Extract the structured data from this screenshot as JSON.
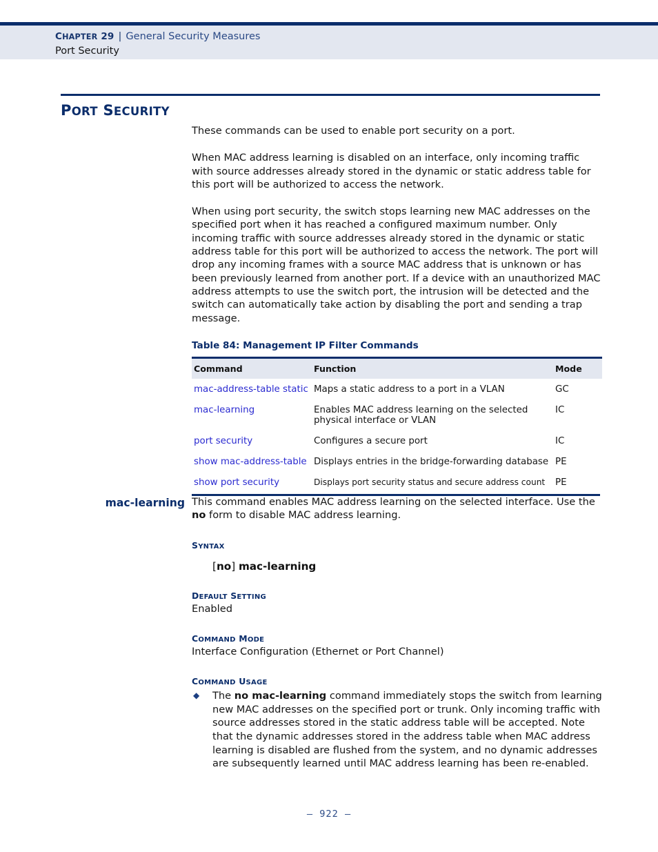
{
  "header": {
    "chapter_label": "Chapter 29",
    "chapter_prefix": "C",
    "chapter_rest": "HAPTER",
    "chapter_number": "29",
    "separator": "|",
    "topic": "General Security Measures",
    "subtitle": "Port Security"
  },
  "section": {
    "title_first": "P",
    "title_first_rest": "ORT",
    "title_second": "S",
    "title_second_rest": "ECURITY",
    "title_plain": "Port Security"
  },
  "intro": {
    "p1": "These commands can be used to enable port security on a port.",
    "p2": "When MAC address learning is disabled on an interface, only incoming traffic with source addresses already stored in the dynamic or static address table for this port will be authorized to access the network.",
    "p3": "When using port security, the switch stops learning new MAC addresses on the specified port when it has reached a configured maximum number. Only incoming traffic with source addresses already stored in the dynamic or static address table for this port will be authorized to access the network. The port will drop any incoming frames with a source MAC address that is unknown or has been previously learned from another port. If a device with an unauthorized MAC address attempts to use the switch port, the intrusion will be detected and the switch can automatically take action by disabling the port and sending a trap message."
  },
  "table": {
    "caption": "Table 84: Management IP Filter Commands",
    "columns": [
      "Command",
      "Function",
      "Mode"
    ],
    "rows": [
      {
        "command": "mac-address-table static",
        "function": "Maps a static address to a port in a VLAN",
        "mode": "GC"
      },
      {
        "command": "mac-learning",
        "function": "Enables MAC address learning on the selected physical interface or VLAN",
        "mode": "IC"
      },
      {
        "command": "port security",
        "function": "Configures a secure port",
        "mode": "IC"
      },
      {
        "command": "show mac-address-table",
        "function": "Displays entries in the bridge-forwarding database",
        "mode": "PE"
      },
      {
        "command": "show port security",
        "function": "Displays port security status and secure address count",
        "mode": "PE"
      }
    ]
  },
  "command_entry": {
    "name": "mac-learning",
    "intro_part1": "This command enables MAC address learning on the selected interface. Use the ",
    "intro_bold": "no",
    "intro_part2": " form to disable MAC address learning.",
    "syntax_heading_first": "S",
    "syntax_heading_rest": "YNTAX",
    "syntax_open_bracket": "[",
    "syntax_no": "no",
    "syntax_close_bracket": "]",
    "syntax_command": "mac-learning",
    "default_heading_first1": "D",
    "default_heading_rest1": "EFAULT",
    "default_heading_first2": "S",
    "default_heading_rest2": "ETTING",
    "default_value": "Enabled",
    "mode_heading_first1": "C",
    "mode_heading_rest1": "OMMAND",
    "mode_heading_first2": "M",
    "mode_heading_rest2": "ODE",
    "mode_value": "Interface Configuration (Ethernet or Port Channel)",
    "usage_heading_first1": "C",
    "usage_heading_rest1": "OMMAND",
    "usage_heading_first2": "U",
    "usage_heading_rest2": "SAGE",
    "usage_bullet_glyph": "◆",
    "usage_part1": "The ",
    "usage_bold": "no mac-learning",
    "usage_part2": " command immediately stops the switch from learning new MAC addresses on the specified port or trunk. Only incoming traffic with source addresses stored in the static address table will be accepted. Note that the dynamic addresses stored in the address table when MAC address learning is disabled are flushed from the system, and no dynamic addresses are subsequently learned until MAC address learning has been re-enabled."
  },
  "footer": {
    "page_marker": "–  922  –"
  },
  "colors": {
    "navy": "#0b2d6b",
    "header_band": "#e3e7f0",
    "link_blue": "#2a2ad0",
    "topic_blue": "#2b4a86"
  }
}
